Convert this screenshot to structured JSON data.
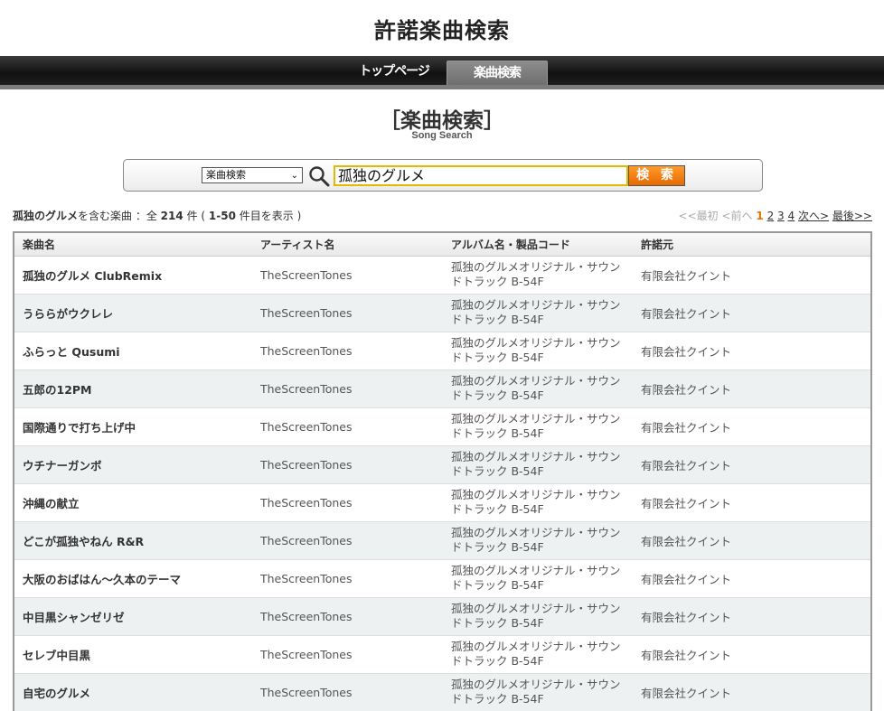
{
  "header": {
    "site_title": "許諾楽曲検索"
  },
  "nav": {
    "top_label": "トップページ",
    "active_label": "楽曲検索"
  },
  "section": {
    "title": "［楽曲検索］",
    "subtitle": "Song Search"
  },
  "search": {
    "select_value": "楽曲検索",
    "input_value": "孤独のグルメ",
    "button_label": "検 索",
    "icon": "search-icon"
  },
  "results": {
    "query": "孤独のグルメ",
    "prefix": "を含む楽曲 ：全",
    "count": "214",
    "unit": "件 (",
    "range": "1-50",
    "suffix": "件目を表示 )"
  },
  "pager": {
    "first": "<<最初",
    "prev": "<前へ",
    "pages": [
      "1",
      "2",
      "3",
      "4"
    ],
    "next": "次へ>",
    "last": "最後>>"
  },
  "table": {
    "headers": [
      "楽曲名",
      "アーティスト名",
      "アルバム名・製品コード",
      "許諾元"
    ],
    "rows": [
      {
        "song": "孤独のグルメ ClubRemix",
        "artist": "TheScreenTones",
        "album": "孤独のグルメオリジナル・サウンドトラック B-54F",
        "licensor": "有限会社クイント"
      },
      {
        "song": "うららがウクレレ",
        "artist": "TheScreenTones",
        "album": "孤独のグルメオリジナル・サウンドトラック B-54F",
        "licensor": "有限会社クイント"
      },
      {
        "song": "ふらっと Qusumi",
        "artist": "TheScreenTones",
        "album": "孤独のグルメオリジナル・サウンドトラック B-54F",
        "licensor": "有限会社クイント"
      },
      {
        "song": "五郎の12PM",
        "artist": "TheScreenTones",
        "album": "孤独のグルメオリジナル・サウンドトラック B-54F",
        "licensor": "有限会社クイント"
      },
      {
        "song": "国際通りで打ち上げ中",
        "artist": "TheScreenTones",
        "album": "孤独のグルメオリジナル・サウンドトラック B-54F",
        "licensor": "有限会社クイント"
      },
      {
        "song": "ウチナーガンボ",
        "artist": "TheScreenTones",
        "album": "孤独のグルメオリジナル・サウンドトラック B-54F",
        "licensor": "有限会社クイント"
      },
      {
        "song": "沖縄の献立",
        "artist": "TheScreenTones",
        "album": "孤独のグルメオリジナル・サウンドトラック B-54F",
        "licensor": "有限会社クイント"
      },
      {
        "song": "どこが孤独やねん R&R",
        "artist": "TheScreenTones",
        "album": "孤独のグルメオリジナル・サウンドトラック B-54F",
        "licensor": "有限会社クイント"
      },
      {
        "song": "大阪のおばはん～久本のテーマ",
        "artist": "TheScreenTones",
        "album": "孤独のグルメオリジナル・サウンドトラック B-54F",
        "licensor": "有限会社クイント"
      },
      {
        "song": "中目黒シャンゼリゼ",
        "artist": "TheScreenTones",
        "album": "孤独のグルメオリジナル・サウンドトラック B-54F",
        "licensor": "有限会社クイント"
      },
      {
        "song": "セレブ中目黒",
        "artist": "TheScreenTones",
        "album": "孤独のグルメオリジナル・サウンドトラック B-54F",
        "licensor": "有限会社クイント"
      },
      {
        "song": "自宅のグルメ",
        "artist": "TheScreenTones",
        "album": "孤独のグルメオリジナル・サウンドトラック B-54F",
        "licensor": "有限会社クイント"
      }
    ]
  },
  "colors": {
    "accent": "#e67300",
    "nav_bg": "#111111",
    "row_alt": "#edf1f1"
  }
}
